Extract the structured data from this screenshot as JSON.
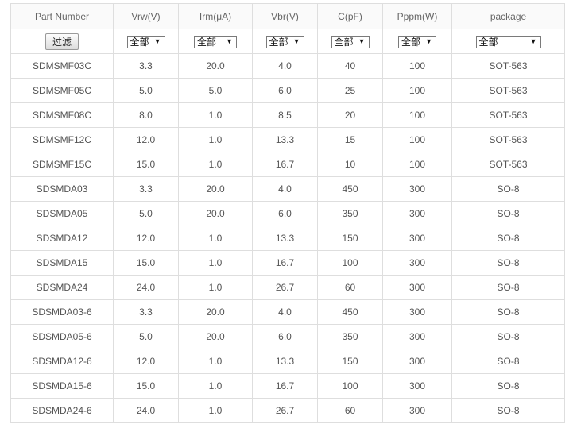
{
  "columns": [
    "Part Number",
    "Vrw(V)",
    "Irm(μA)",
    "Vbr(V)",
    "C(pF)",
    "Pppm(W)",
    "package"
  ],
  "filter": {
    "button_label": "过滤",
    "select_value": "全部"
  },
  "icons": {
    "dropdown": "triangle-down-icon"
  },
  "colors": {
    "border": "#dedede",
    "text": "#555555",
    "header_bg": "#fafafa"
  },
  "rows": [
    [
      "SDMSMF03C",
      "3.3",
      "20.0",
      "4.0",
      "40",
      "100",
      "SOT-563"
    ],
    [
      "SDMSMF05C",
      "5.0",
      "5.0",
      "6.0",
      "25",
      "100",
      "SOT-563"
    ],
    [
      "SDMSMF08C",
      "8.0",
      "1.0",
      "8.5",
      "20",
      "100",
      "SOT-563"
    ],
    [
      "SDMSMF12C",
      "12.0",
      "1.0",
      "13.3",
      "15",
      "100",
      "SOT-563"
    ],
    [
      "SDMSMF15C",
      "15.0",
      "1.0",
      "16.7",
      "10",
      "100",
      "SOT-563"
    ],
    [
      "SDSMDA03",
      "3.3",
      "20.0",
      "4.0",
      "450",
      "300",
      "SO-8"
    ],
    [
      "SDSMDA05",
      "5.0",
      "20.0",
      "6.0",
      "350",
      "300",
      "SO-8"
    ],
    [
      "SDSMDA12",
      "12.0",
      "1.0",
      "13.3",
      "150",
      "300",
      "SO-8"
    ],
    [
      "SDSMDA15",
      "15.0",
      "1.0",
      "16.7",
      "100",
      "300",
      "SO-8"
    ],
    [
      "SDSMDA24",
      "24.0",
      "1.0",
      "26.7",
      "60",
      "300",
      "SO-8"
    ],
    [
      "SDSMDA03-6",
      "3.3",
      "20.0",
      "4.0",
      "450",
      "300",
      "SO-8"
    ],
    [
      "SDSMDA05-6",
      "5.0",
      "20.0",
      "6.0",
      "350",
      "300",
      "SO-8"
    ],
    [
      "SDSMDA12-6",
      "12.0",
      "1.0",
      "13.3",
      "150",
      "300",
      "SO-8"
    ],
    [
      "SDSMDA15-6",
      "15.0",
      "1.0",
      "16.7",
      "100",
      "300",
      "SO-8"
    ],
    [
      "SDSMDA24-6",
      "24.0",
      "1.0",
      "26.7",
      "60",
      "300",
      "SO-8"
    ]
  ]
}
